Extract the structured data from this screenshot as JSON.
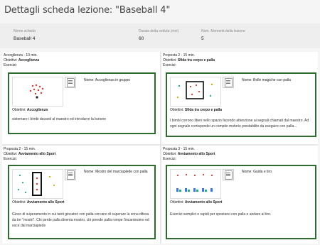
{
  "page": {
    "title": "Dettagli scheda lezione: \"Baseball 4\""
  },
  "summary": {
    "name_label": "Nome scheda",
    "name_value": "Baseball 4",
    "duration_label": "Durata della seduta (min)",
    "duration_value": "60",
    "moments_label": "Num. Momenti della lezione",
    "moments_value": "5"
  },
  "cards": [
    {
      "heading": "Accoglienza - 10 min.",
      "obiettivi_label": "Obiettivi:",
      "obiettivi_value": "Accoglienza",
      "esercizi": "Esercizi:",
      "nome_label": "Nome:",
      "nome_value": "Accoglienza in gruppo",
      "inner_obiettivi_label": "Obiettivi:",
      "inner_obiettivi_value": "Accoglienza",
      "description": "sistemare i bimbi davanti al maestro ed introdurre la lezione"
    },
    {
      "heading": "Proposta 2 - 15 min.",
      "obiettivi_label": "Obiettivi:",
      "obiettivi_value": "Sfida tra corpo e palla",
      "esercizi": "Esercizi:",
      "nome_label": "Nome:",
      "nome_value": "Bolle magiche con palla",
      "inner_obiettivi_label": "Obiettivi:",
      "inner_obiettivi_value": "Sfida tra corpo e palla",
      "description": "I bimbi corrono liberi nello spazio facendo attenzione ai segnali chiamati dal maestro. Ad ogni segnale corrisponde un compito motorio prestabilito da eseguire con palla..."
    },
    {
      "heading": "Proposta 2 - 15 min.",
      "obiettivi_label": "Obiettivi:",
      "obiettivi_value": "Avviamento allo Sport",
      "esercizi": "Esercizi:",
      "nome_label": "Nome:",
      "nome_value": "Mostro del marciapiede con palla",
      "inner_obiettivi_label": "Obiettivi:",
      "inner_obiettivi_value": "Avviamento allo Sport",
      "description": "Gioco di superamento in cui tanti giocatori con palla cercano di superare la zona difesa da tre \"mostri\". Chi perde palla diventa mostro, chi prende palla rompe l'incantesimo ed esce dal marciapiede"
    },
    {
      "heading": "Proposta 3 - 15 min.",
      "obiettivi_label": "Obiettivi:",
      "obiettivi_value": "Avviamento allo Sport",
      "esercizi": "Esercizi:",
      "nome_label": "Nome:",
      "nome_value": "Guida e tiro",
      "inner_obiettivi_label": "Obiettivi:",
      "inner_obiettivi_value": "Avviamento allo Sport",
      "description": "Esercizi semplici e rapidi per spostarsi con palla e andare al tiro."
    }
  ]
}
